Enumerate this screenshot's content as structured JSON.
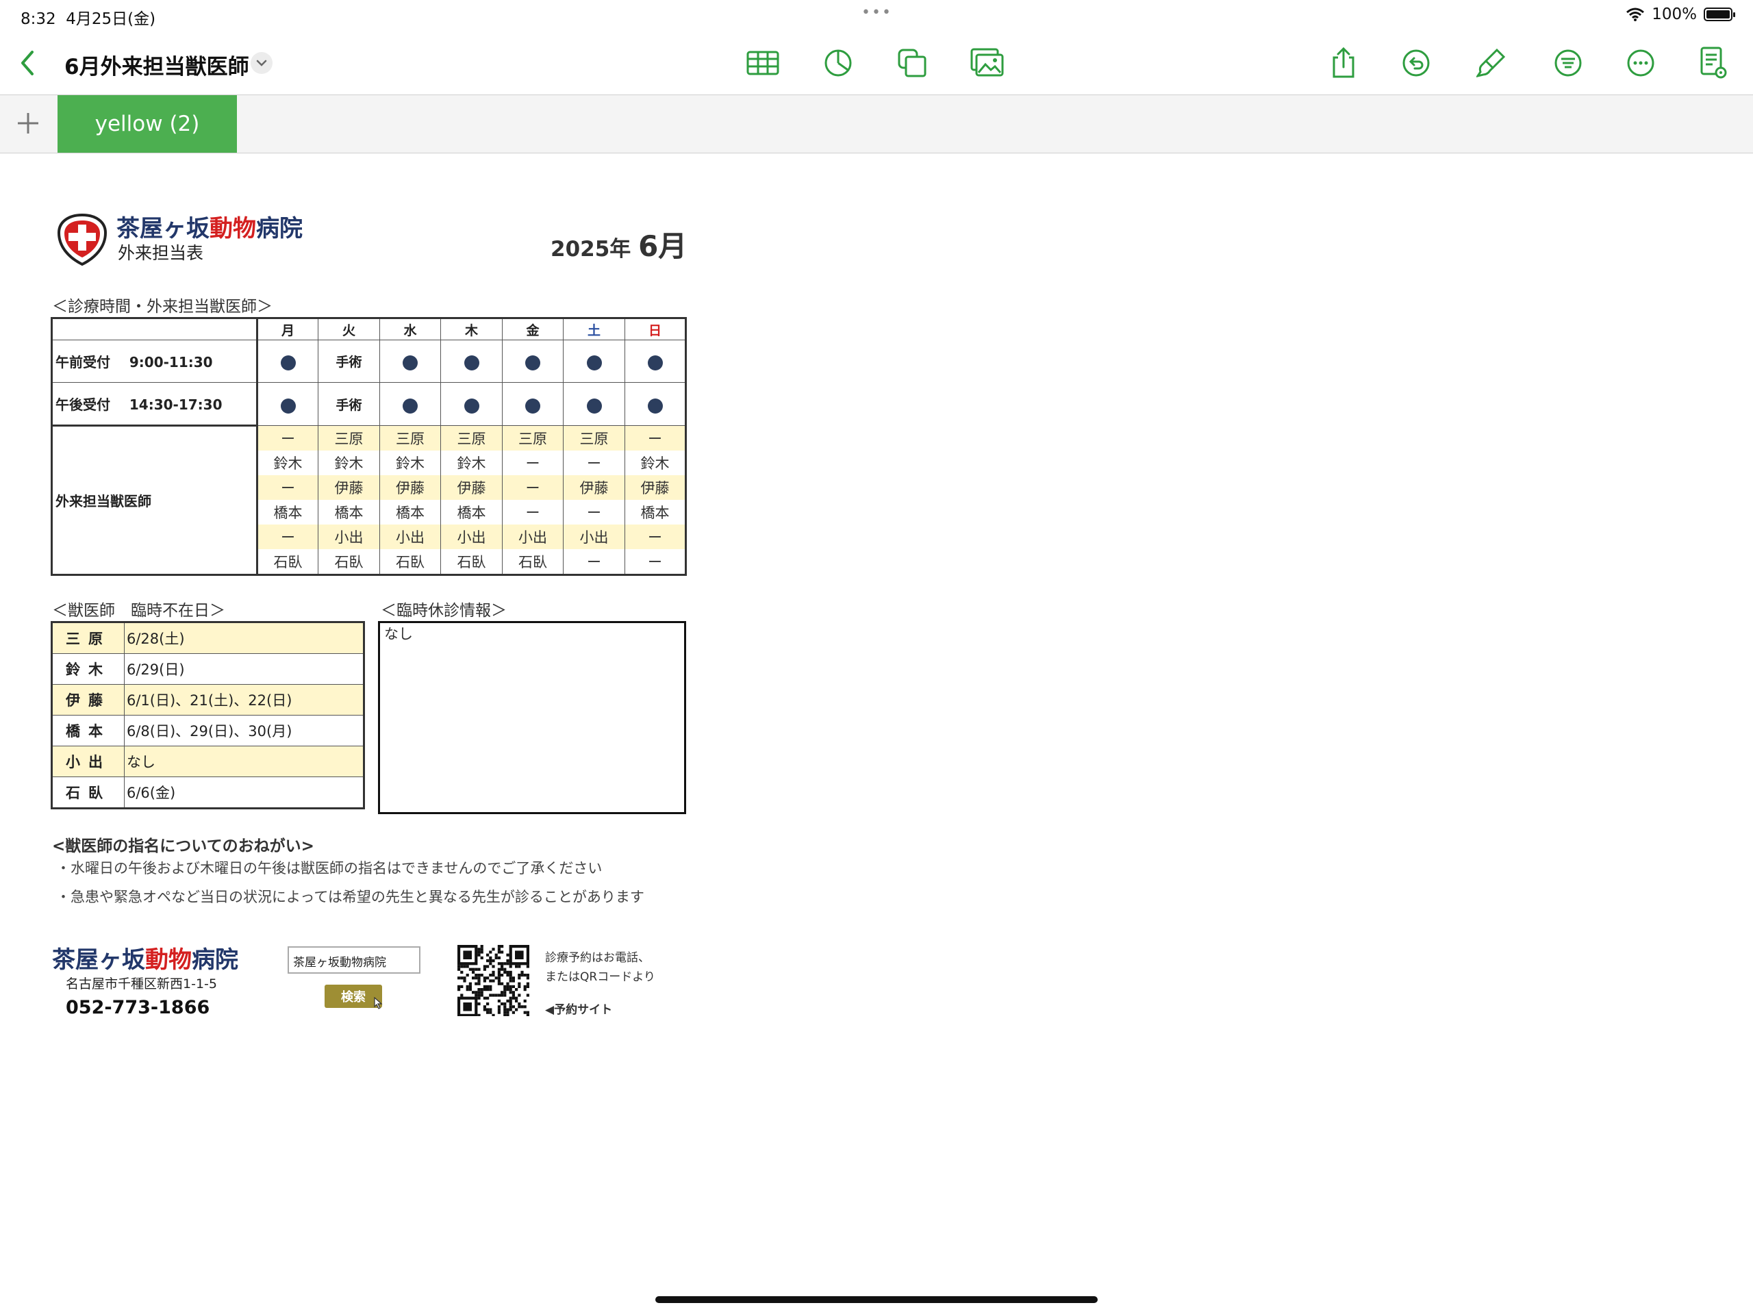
{
  "status_bar": {
    "time": "8:32",
    "date": "4月25日(金)",
    "battery": "100%"
  },
  "toolbar": {
    "title": "6月外来担当獣医師"
  },
  "tabs": [
    {
      "label": "yellow (2)"
    }
  ],
  "colors": {
    "accent": "#4caf50",
    "brand_blue": "#22376a",
    "brand_red": "#d42020",
    "highlight": "#fff6cc",
    "button_olive": "#9e8e34"
  },
  "header": {
    "name_part1": "茶屋ヶ坂",
    "name_part2": "動物",
    "name_part3": "病院",
    "subtitle": "外来担当表",
    "year": "2025年",
    "month": "6月"
  },
  "schedule": {
    "section_label": "＜診療時間・外来担当獣医師＞",
    "days": [
      "月",
      "火",
      "水",
      "木",
      "金",
      "土",
      "日"
    ],
    "morning": {
      "label": "午前受付",
      "time": "9:00-11:30"
    },
    "afternoon": {
      "label": "午後受付",
      "time": "14:30-17:30"
    },
    "surgery_label": "手術",
    "vets_label": "外来担当獣医師",
    "vet_rows": [
      [
        "ー",
        "三原",
        "三原",
        "三原",
        "三原",
        "三原",
        "ー"
      ],
      [
        "鈴木",
        "鈴木",
        "鈴木",
        "鈴木",
        "ー",
        "ー",
        "鈴木"
      ],
      [
        "ー",
        "伊藤",
        "伊藤",
        "伊藤",
        "ー",
        "伊藤",
        "伊藤"
      ],
      [
        "橋本",
        "橋本",
        "橋本",
        "橋本",
        "ー",
        "ー",
        "橋本"
      ],
      [
        "ー",
        "小出",
        "小出",
        "小出",
        "小出",
        "小出",
        "ー"
      ],
      [
        "石臥",
        "石臥",
        "石臥",
        "石臥",
        "石臥",
        "ー",
        "ー"
      ]
    ]
  },
  "absence": {
    "section_label": "＜獣医師　臨時不在日＞",
    "rows": [
      {
        "name": "三原",
        "dates": "6/28(土)"
      },
      {
        "name": "鈴木",
        "dates": "6/29(日)"
      },
      {
        "name": "伊藤",
        "dates": "6/1(日)、21(土)、22(日)"
      },
      {
        "name": "橋本",
        "dates": "6/8(日)、29(日)、30(月)"
      },
      {
        "name": "小出",
        "dates": "なし"
      },
      {
        "name": "石臥",
        "dates": "6/6(金)"
      }
    ]
  },
  "closure": {
    "section_label": "＜臨時休診情報＞",
    "text": "なし"
  },
  "request": {
    "heading": "<獣医師の指名についてのおねがい>",
    "notes": [
      "・水曜日の午後および木曜日の午後は獣医師の指名はできませんのでご了承ください",
      "・急患や緊急オペなど当日の状況によっては希望の先生と異なる先生が診ることがあります"
    ]
  },
  "footer": {
    "address": "名古屋市千種区新西1-1-5",
    "phone": "052-773-1866",
    "search_text": "茶屋ヶ坂動物病院",
    "search_button": "検索",
    "qr_line1": "診療予約はお電話、",
    "qr_line2": "またはQRコードより",
    "qr_line3": "◀予約サイト"
  },
  "icons": [
    "back-chevron-icon",
    "table-icon",
    "chart-icon",
    "shape-icon",
    "media-icon",
    "share-icon",
    "undo-icon",
    "paintbrush-icon",
    "format-icon",
    "more-icon",
    "document-view-icon",
    "plus-icon",
    "wifi-icon",
    "battery-icon",
    "search-cursor-icon",
    "qr-code-icon"
  ]
}
